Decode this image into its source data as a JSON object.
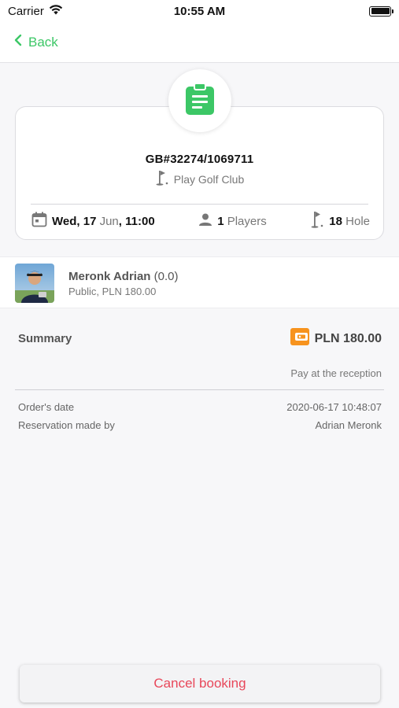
{
  "status_bar": {
    "carrier": "Carrier",
    "time": "10:55 AM"
  },
  "nav": {
    "back_label": "Back"
  },
  "booking": {
    "code": "GB#32274/1069711",
    "club": "Play Golf Club",
    "date_day": "Wed, 17",
    "date_month": "Jun",
    "date_time": "11:00",
    "players_count": "1",
    "players_label": "Players",
    "holes_count": "18",
    "holes_label": "Hole"
  },
  "player": {
    "name": "Meronk Adrian",
    "rating": "(0.0)",
    "details": "Public, PLN 180.00"
  },
  "summary": {
    "label": "Summary",
    "amount": "PLN 180.00",
    "payment_note": "Pay at the reception"
  },
  "info": [
    {
      "label": "Order's date",
      "value": "2020-06-17 10:48:07"
    },
    {
      "label": "Reservation made by",
      "value": "Adrian Meronk"
    }
  ],
  "actions": {
    "cancel_label": "Cancel booking"
  },
  "colors": {
    "accent_green": "#3cc766",
    "cancel_red": "#e8475a",
    "wallet_orange": "#f7931e"
  }
}
